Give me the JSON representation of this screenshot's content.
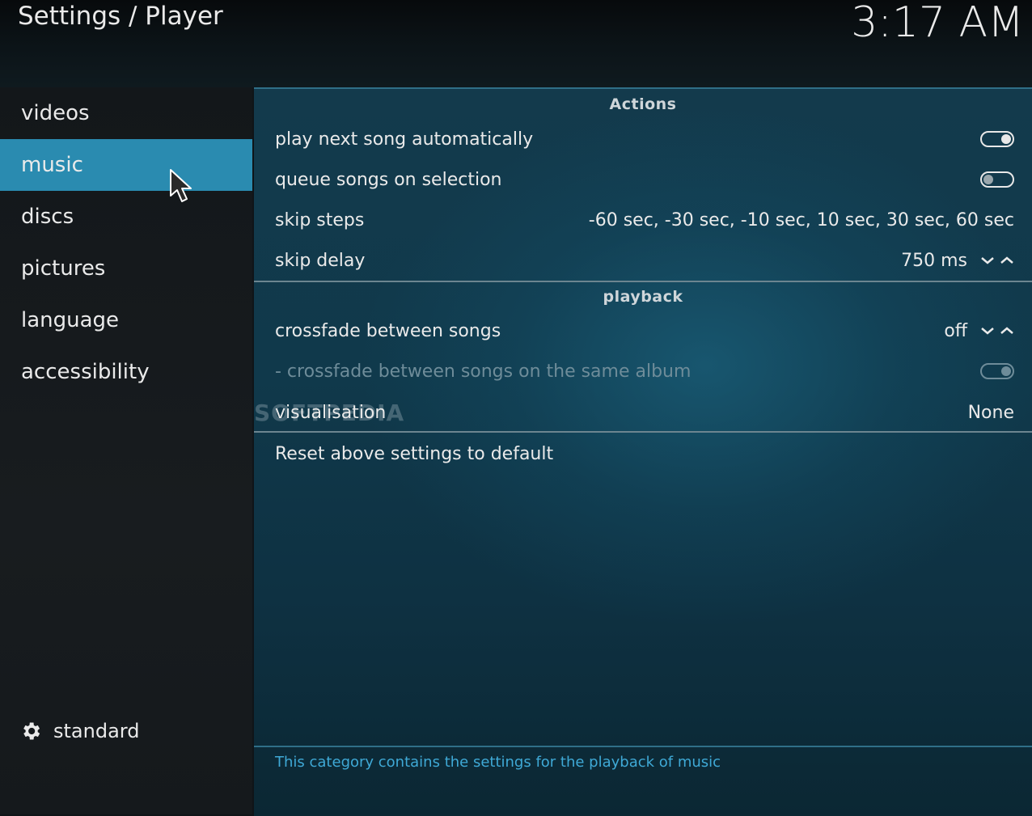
{
  "header": {
    "title": "Settings / Player",
    "clock": "3:17 AM"
  },
  "sidebar": {
    "items": [
      {
        "label": "videos"
      },
      {
        "label": "music",
        "active": true
      },
      {
        "label": "discs"
      },
      {
        "label": "pictures"
      },
      {
        "label": "language"
      },
      {
        "label": "accessibility"
      }
    ],
    "level_label": "standard"
  },
  "main": {
    "actions_header": "Actions",
    "play_next_label": "play next song automatically",
    "play_next_state": "on",
    "queue_label": "queue songs on selection",
    "queue_state": "off",
    "skip_steps_label": "skip steps",
    "skip_steps_value": "-60 sec, -30 sec, -10 sec, 10 sec, 30 sec, 60 sec",
    "skip_delay_label": "skip delay",
    "skip_delay_value": "750 ms",
    "playback_header": "playback",
    "crossfade_label": "crossfade between songs",
    "crossfade_value": "off",
    "crossfade_album_label": "- crossfade between songs on the same album",
    "crossfade_album_state": "on (disabled)",
    "visualisation_label": "visualisation",
    "visualisation_value": "None",
    "reset_label": "Reset above settings to default",
    "info_text": "This category contains the settings for the playback of music",
    "watermark": "SOFTPEDIA"
  },
  "colors": {
    "accent": "#2a8bb0",
    "info_text": "#3fa9d6"
  }
}
